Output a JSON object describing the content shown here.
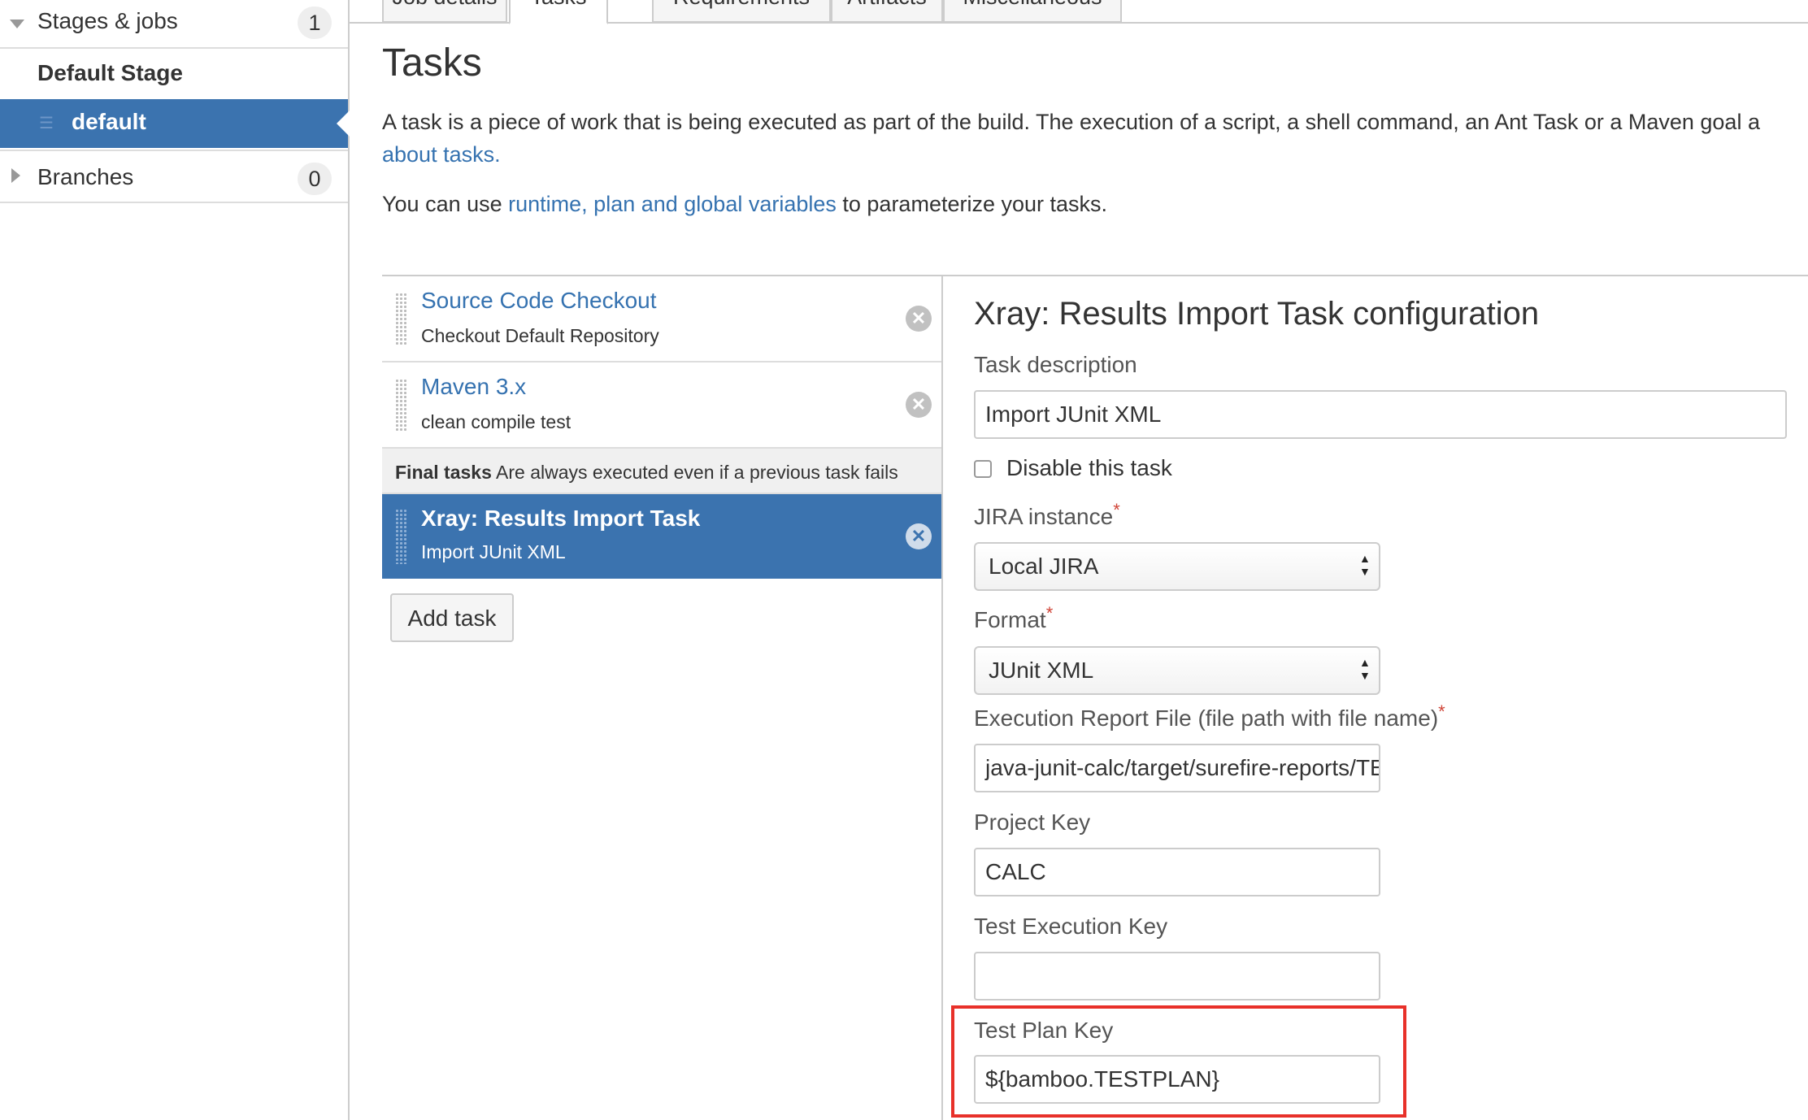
{
  "sidebar": {
    "stages_label": "Stages & jobs",
    "stages_count": "1",
    "default_stage": "Default Stage",
    "default_job": "default",
    "branches_label": "Branches",
    "branches_count": "0"
  },
  "tabs": [
    {
      "label": "Job details"
    },
    {
      "label": "Tasks"
    },
    {
      "label": "Requirements"
    },
    {
      "label": "Artifacts"
    },
    {
      "label": "Miscellaneous"
    }
  ],
  "header": {
    "title": "Tasks",
    "intro_text": "A task is a piece of work that is being executed as part of the build. The execution of a script, a shell command, an Ant Task or a Maven goal a",
    "intro_link": "about tasks.",
    "vars_prefix": "You can use ",
    "vars_link": "runtime, plan and global variables",
    "vars_suffix": " to parameterize your tasks."
  },
  "tasks": [
    {
      "title": "Source Code Checkout",
      "subtitle": "Checkout Default Repository"
    },
    {
      "title": "Maven 3.x",
      "subtitle": "clean compile test"
    },
    {
      "title": "Xray: Results Import Task",
      "subtitle": "Import JUnit XML"
    }
  ],
  "final_tasks": {
    "label": "Final tasks",
    "note": "Are always executed even if a previous task fails"
  },
  "add_task_label": "Add task",
  "config": {
    "title": "Xray: Results Import Task configuration",
    "task_description_label": "Task description",
    "task_description_value": "Import JUnit XML",
    "disable_label": "Disable this task",
    "jira_instance_label": "JIRA instance",
    "jira_instance_value": "Local JIRA",
    "format_label": "Format",
    "format_value": "JUnit XML",
    "report_file_label": "Execution Report File (file path with file name)",
    "report_file_value": "java-junit-calc/target/surefire-reports/TE",
    "project_key_label": "Project Key",
    "project_key_value": "CALC",
    "test_execution_key_label": "Test Execution Key",
    "test_execution_key_value": "",
    "test_plan_key_label": "Test Plan Key",
    "test_plan_key_value": "${bamboo.TESTPLAN}",
    "required_mark": "*"
  },
  "colors": {
    "accent": "#3b73af",
    "link": "#3572b0",
    "highlight": "#e8312a",
    "required": "#d04437"
  }
}
